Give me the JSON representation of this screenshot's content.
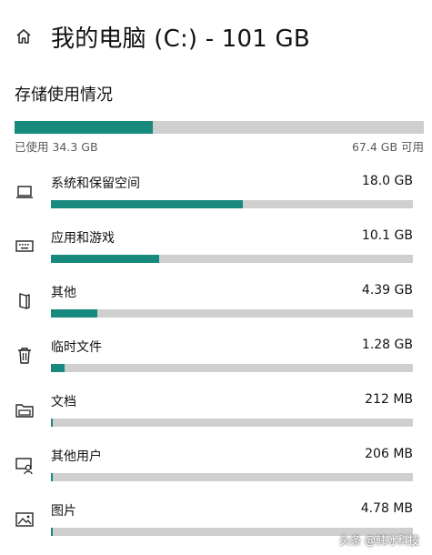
{
  "header": {
    "title": "我的电脑 (C:) - 101 GB"
  },
  "storage": {
    "section_title": "存储使用情况",
    "used_label": "已使用 34.3 GB",
    "free_label": "67.4 GB 可用",
    "used_fraction": 0.337,
    "accent_color": "#188a7d",
    "track_color": "#cfcfcf"
  },
  "categories": [
    {
      "name": "系统和保留空间",
      "size": "18.0 GB",
      "fraction": 0.53,
      "icon": "laptop-icon"
    },
    {
      "name": "应用和游戏",
      "size": "10.1 GB",
      "fraction": 0.3,
      "icon": "keyboard-icon"
    },
    {
      "name": "其他",
      "size": "4.39 GB",
      "fraction": 0.128,
      "icon": "other-doc-icon"
    },
    {
      "name": "临时文件",
      "size": "1.28 GB",
      "fraction": 0.038,
      "icon": "trash-icon"
    },
    {
      "name": "文档",
      "size": "212 MB",
      "fraction": 0.006,
      "icon": "folder-icon"
    },
    {
      "name": "其他用户",
      "size": "206 MB",
      "fraction": 0.006,
      "icon": "users-icon"
    },
    {
      "name": "图片",
      "size": "4.78 MB",
      "fraction": 0.001,
      "icon": "picture-icon"
    }
  ],
  "watermark": "头条 @韩冰科技"
}
